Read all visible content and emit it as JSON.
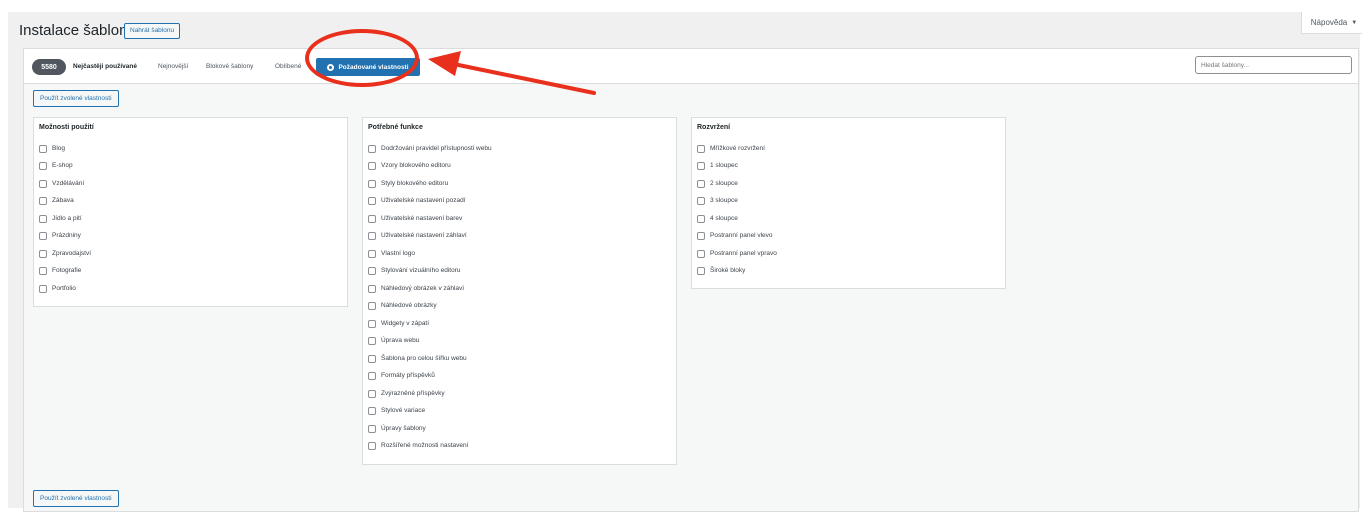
{
  "header": {
    "title": "Instalace šablon",
    "upload_label": "Nahrát šablonu",
    "help_label": "Nápověda"
  },
  "filter_bar": {
    "count": "5580",
    "tabs": [
      {
        "label": "Nejčastěji používané",
        "current": true
      },
      {
        "label": "Nejnovější"
      },
      {
        "label": "Blokové šablony"
      },
      {
        "label": "Oblíbené"
      }
    ],
    "feature_filter_label": "Požadované vlastnosti",
    "search_placeholder": "Hledat šablony..."
  },
  "apply_label": "Použít zvolené vlastnosti",
  "groups": [
    {
      "title": "Možnosti použití",
      "options": [
        "Blog",
        "E-shop",
        "Vzdělávání",
        "Zábava",
        "Jídlo a pití",
        "Prázdniny",
        "Zpravodajství",
        "Fotografie",
        "Portfolio"
      ]
    },
    {
      "title": "Potřebné funkce",
      "options": [
        "Dodržování pravidel přístupnosti webu",
        "Vzory blokového editoru",
        "Styly blokového editoru",
        "Uživatelské nastavení pozadí",
        "Uživatelské nastavení barev",
        "Uživatelské nastavení záhlaví",
        "Vlastní logo",
        "Stylování vizuálního editoru",
        "Náhledový obrázek v záhlaví",
        "Náhledové obrázky",
        "Widgety v zápatí",
        "Úprava webu",
        "Šablona pro celou šířku webu",
        "Formáty příspěvků",
        "Zvýrazněné příspěvky",
        "Stylové variace",
        "Úpravy šablony",
        "Rozšířené možnosti nastavení"
      ]
    },
    {
      "title": "Rozvržení",
      "options": [
        "Mřížkové rozvržení",
        "1 sloupec",
        "2 sloupce",
        "3 sloupce",
        "4 sloupce",
        "Postranní panel vlevo",
        "Postranní panel vpravo",
        "Široké bloky"
      ]
    }
  ],
  "colors": {
    "accent": "#2271b1",
    "annotation": "#e8301c"
  }
}
